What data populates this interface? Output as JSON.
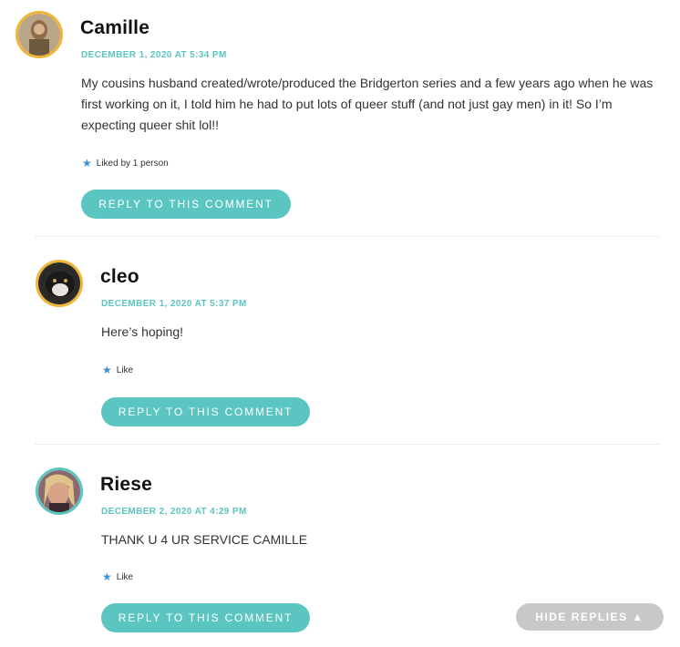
{
  "comments": [
    {
      "author": "Camille",
      "date": "DECEMBER 1, 2020 AT 5:34 PM",
      "text": "My cousins husband created/wrote/produced the Bridgerton series and a few years ago when he was first working on it, I told him he had to put lots of queer stuff (and not just gay men) in it! So I’m expecting queer shit lol!!",
      "like_text": "Liked by 1 person",
      "reply_label": "REPLY TO THIS COMMENT"
    },
    {
      "author": "cleo",
      "date": "DECEMBER 1, 2020 AT 5:37 PM",
      "text": "Here’s hoping!",
      "like_text": "Like",
      "reply_label": "REPLY TO THIS COMMENT"
    },
    {
      "author": "Riese",
      "date": "DECEMBER 2, 2020 AT 4:29 PM",
      "text": "THANK U 4 UR SERVICE CAMILLE",
      "like_text": "Like",
      "reply_label": "REPLY TO THIS COMMENT"
    }
  ],
  "hide_replies_label": "HIDE REPLIES ▲",
  "colors": {
    "accent": "#5bc5c1",
    "avatar_border_gold": "#f0b537",
    "star": "#3b8fd4"
  }
}
